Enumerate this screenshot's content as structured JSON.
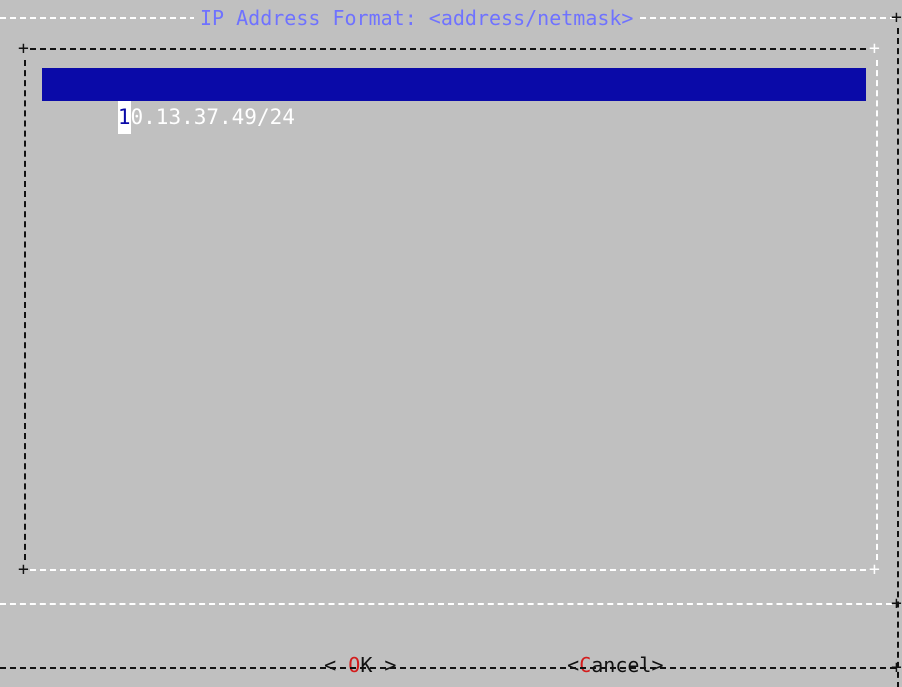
{
  "dialog": {
    "title": "IP Address Format: <address/netmask>"
  },
  "address_list": {
    "items": [
      {
        "first_char": "1",
        "rest": "0.13.37.49/24"
      }
    ]
  },
  "buttons": {
    "ok": {
      "left": "< ",
      "hotkey": "O",
      "rest": "K >"
    },
    "cancel": {
      "left": "<",
      "hotkey": "C",
      "rest": "ancel>"
    }
  },
  "colors": {
    "background": "#c0c0c0",
    "selection": "#0a0aa8",
    "title": "#6f72ff",
    "hotkey": "#d41c1c"
  }
}
